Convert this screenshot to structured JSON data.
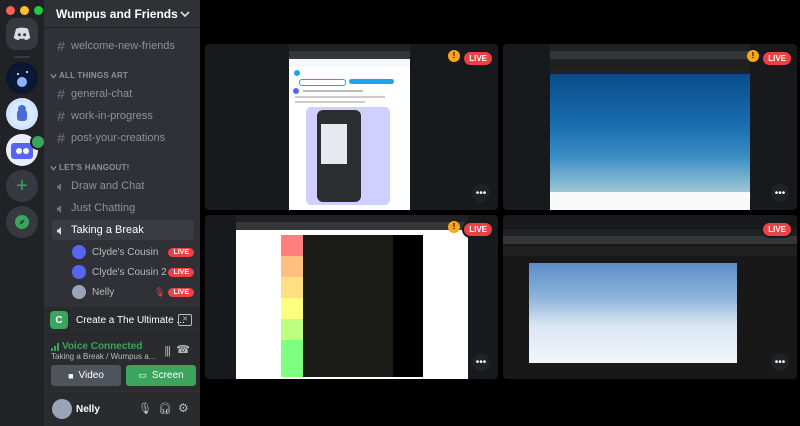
{
  "server": {
    "name": "Wumpus and Friends"
  },
  "channels": {
    "welcome": "welcome-new-friends",
    "cat_art": "ALL THINGS ART",
    "art": [
      "general-chat",
      "work-in-progress",
      "post-your-creations"
    ],
    "cat_hangout": "LET'S HANGOUT!",
    "voice": [
      "Draw and Chat",
      "Just Chatting",
      "Taking a Break"
    ]
  },
  "voice_users": [
    {
      "name": "Clyde's Cousin",
      "live": "LIVE"
    },
    {
      "name": "Clyde's Cousin 2",
      "live": "LIVE"
    },
    {
      "name": "Nelly",
      "live": "LIVE"
    }
  ],
  "activity": {
    "label": "Create a The Ultimate ..."
  },
  "connection": {
    "status": "Voice Connected",
    "location": "Taking a Break / Wumpus a...",
    "video": "Video",
    "screen": "Screen"
  },
  "user": {
    "name": "Nelly"
  },
  "streams": [
    {
      "live": "LIVE",
      "warn": "!"
    },
    {
      "live": "LIVE",
      "warn": "!"
    },
    {
      "live": "LIVE",
      "warn": "!"
    },
    {
      "live": "LIVE"
    }
  ],
  "more_glyph": "•••",
  "colors": {
    "blurple": "#5865f2",
    "live": "#ed4245",
    "green": "#3ba55d",
    "warn": "#faa61a"
  }
}
